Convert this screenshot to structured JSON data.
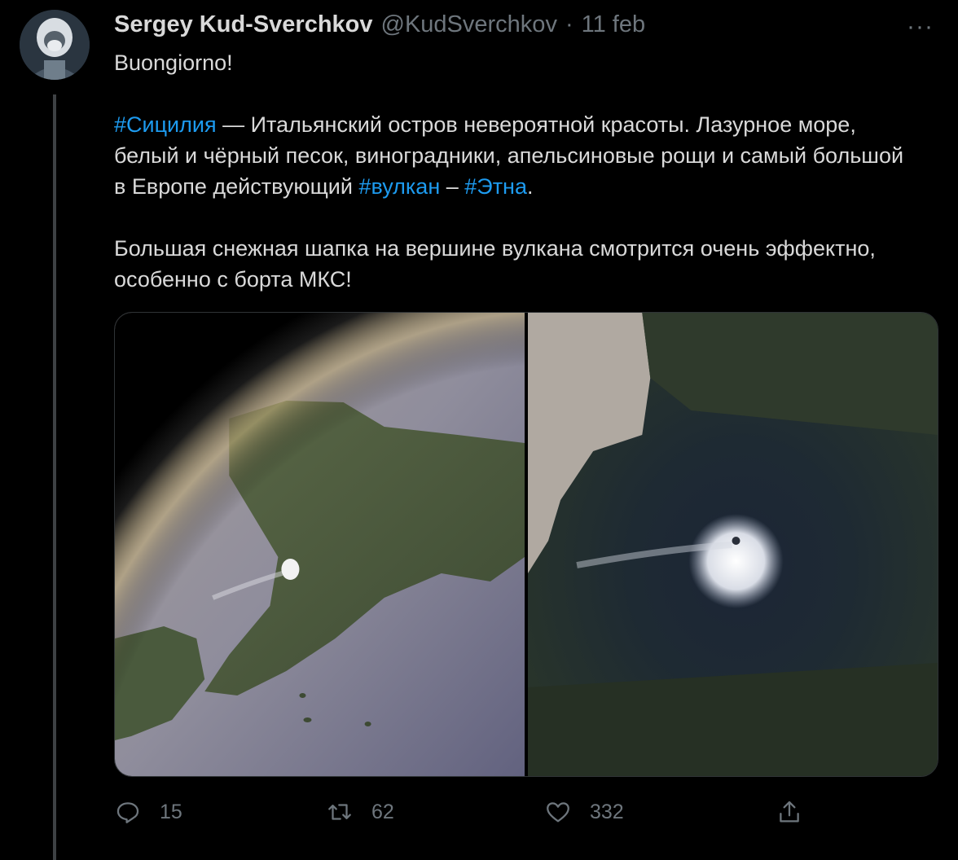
{
  "tweet": {
    "author_name": "Sergey Kud-Sverchkov",
    "author_handle": "@KudSverchkov",
    "separator": "·",
    "date": "11 feb",
    "more_label": "···",
    "greeting": "Buongiorno!",
    "paragraph2": {
      "tag1": "#Сицилия",
      "text1": " — Итальянский остров невероятной красоты. Лазурное море, белый и чёрный песок, виноградники, апельсиновые рощи и самый большой в Европе действующий ",
      "tag2": "#вулкан",
      "text2": " – ",
      "tag3": "#Этна",
      "text3": "."
    },
    "paragraph3": "Большая снежная шапка на вершине вулкана смотрится очень эффектно, особенно с борта МКС!",
    "link_color": "#1d9bf0"
  },
  "media": {
    "images": [
      "sicily-from-orbit-photo",
      "etna-snowcap-photo"
    ]
  },
  "actions": {
    "reply_count": "15",
    "retweet_count": "62",
    "like_count": "332",
    "icons": [
      "reply-icon",
      "retweet-icon",
      "like-icon",
      "share-icon"
    ]
  }
}
